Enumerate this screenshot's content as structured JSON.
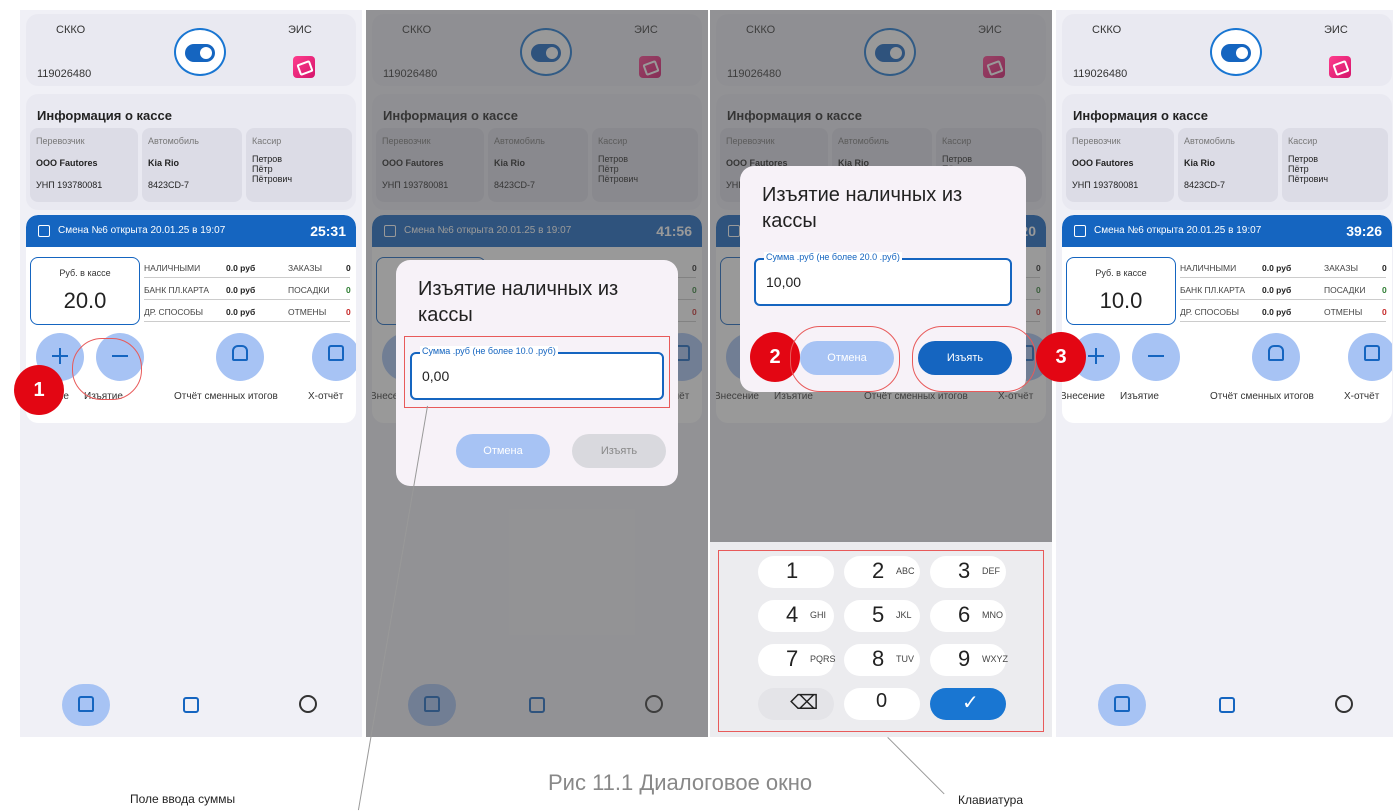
{
  "status": {
    "left_label": "СККО",
    "right_label": "ЭИС",
    "kkt_number": "119026480"
  },
  "info": {
    "title": "Информация о кассе",
    "carrier_h": "Перевозчик",
    "carrier": "ООО Fautores",
    "unp": "УНП 193780081",
    "car_h": "Автомобиль",
    "car": "Kia Rio",
    "plate": "8423CD-7",
    "cashier_h": "Кассир",
    "cashier": "Петров\nПётр\nПётрович"
  },
  "shift": {
    "text": "Смена №6 открыта 20.01.25 в 19:07",
    "time1": "25:31",
    "time2": "41:56",
    "time3": "20",
    "time4": "39:26"
  },
  "cash": {
    "label": "Руб. в кассе",
    "value1": "20.0",
    "value4": "10.0"
  },
  "stats": {
    "cash_h": "НАЛИЧНЫМИ",
    "card_h": "БАНК ПЛ.КАРТА",
    "other_h": "ДР. СПОСОБЫ",
    "amount": "0.0 руб",
    "orders_h": "ЗАКАЗЫ",
    "orders": "0",
    "boarding_h": "ПОСАДКИ",
    "boarding": "0",
    "cancel_h": "ОТМЕНЫ",
    "cancel": "0"
  },
  "actions": {
    "deposit": "Внесение",
    "withdraw": "Изъятие",
    "report": "Отчёт сменных итогов",
    "x_report": "X-отчёт"
  },
  "dialog": {
    "title": "Изъятие наличных из кассы",
    "field_label1": "Сумма .руб (не более 10.0 .руб)",
    "value1": "0,00",
    "field_label2": "Сумма .руб (не более 20.0 .руб)",
    "value2": "10,00",
    "cancel": "Отмена",
    "withdraw": "Изъять"
  },
  "keyboard": [
    {
      "n": "1",
      "s": ""
    },
    {
      "n": "2",
      "s": "ABC"
    },
    {
      "n": "3",
      "s": "DEF"
    },
    {
      "n": "4",
      "s": "GHI"
    },
    {
      "n": "5",
      "s": "JKL"
    },
    {
      "n": "6",
      "s": "MNO"
    },
    {
      "n": "7",
      "s": "PQRS"
    },
    {
      "n": "8",
      "s": "TUV"
    },
    {
      "n": "9",
      "s": "WXYZ"
    },
    {
      "n": "⌫",
      "s": ""
    },
    {
      "n": "0",
      "s": ""
    },
    {
      "n": "✓",
      "s": ""
    }
  ],
  "markers": [
    "1",
    "2",
    "3"
  ],
  "caption": "Рис 11.1 Диалоговое окно",
  "notes": {
    "field": "Поле ввода суммы",
    "keyboard": "Клавиатура"
  },
  "colors": {
    "accent": "#1565c0",
    "marker": "#e30613",
    "light_btn": "#a7c3f4"
  }
}
